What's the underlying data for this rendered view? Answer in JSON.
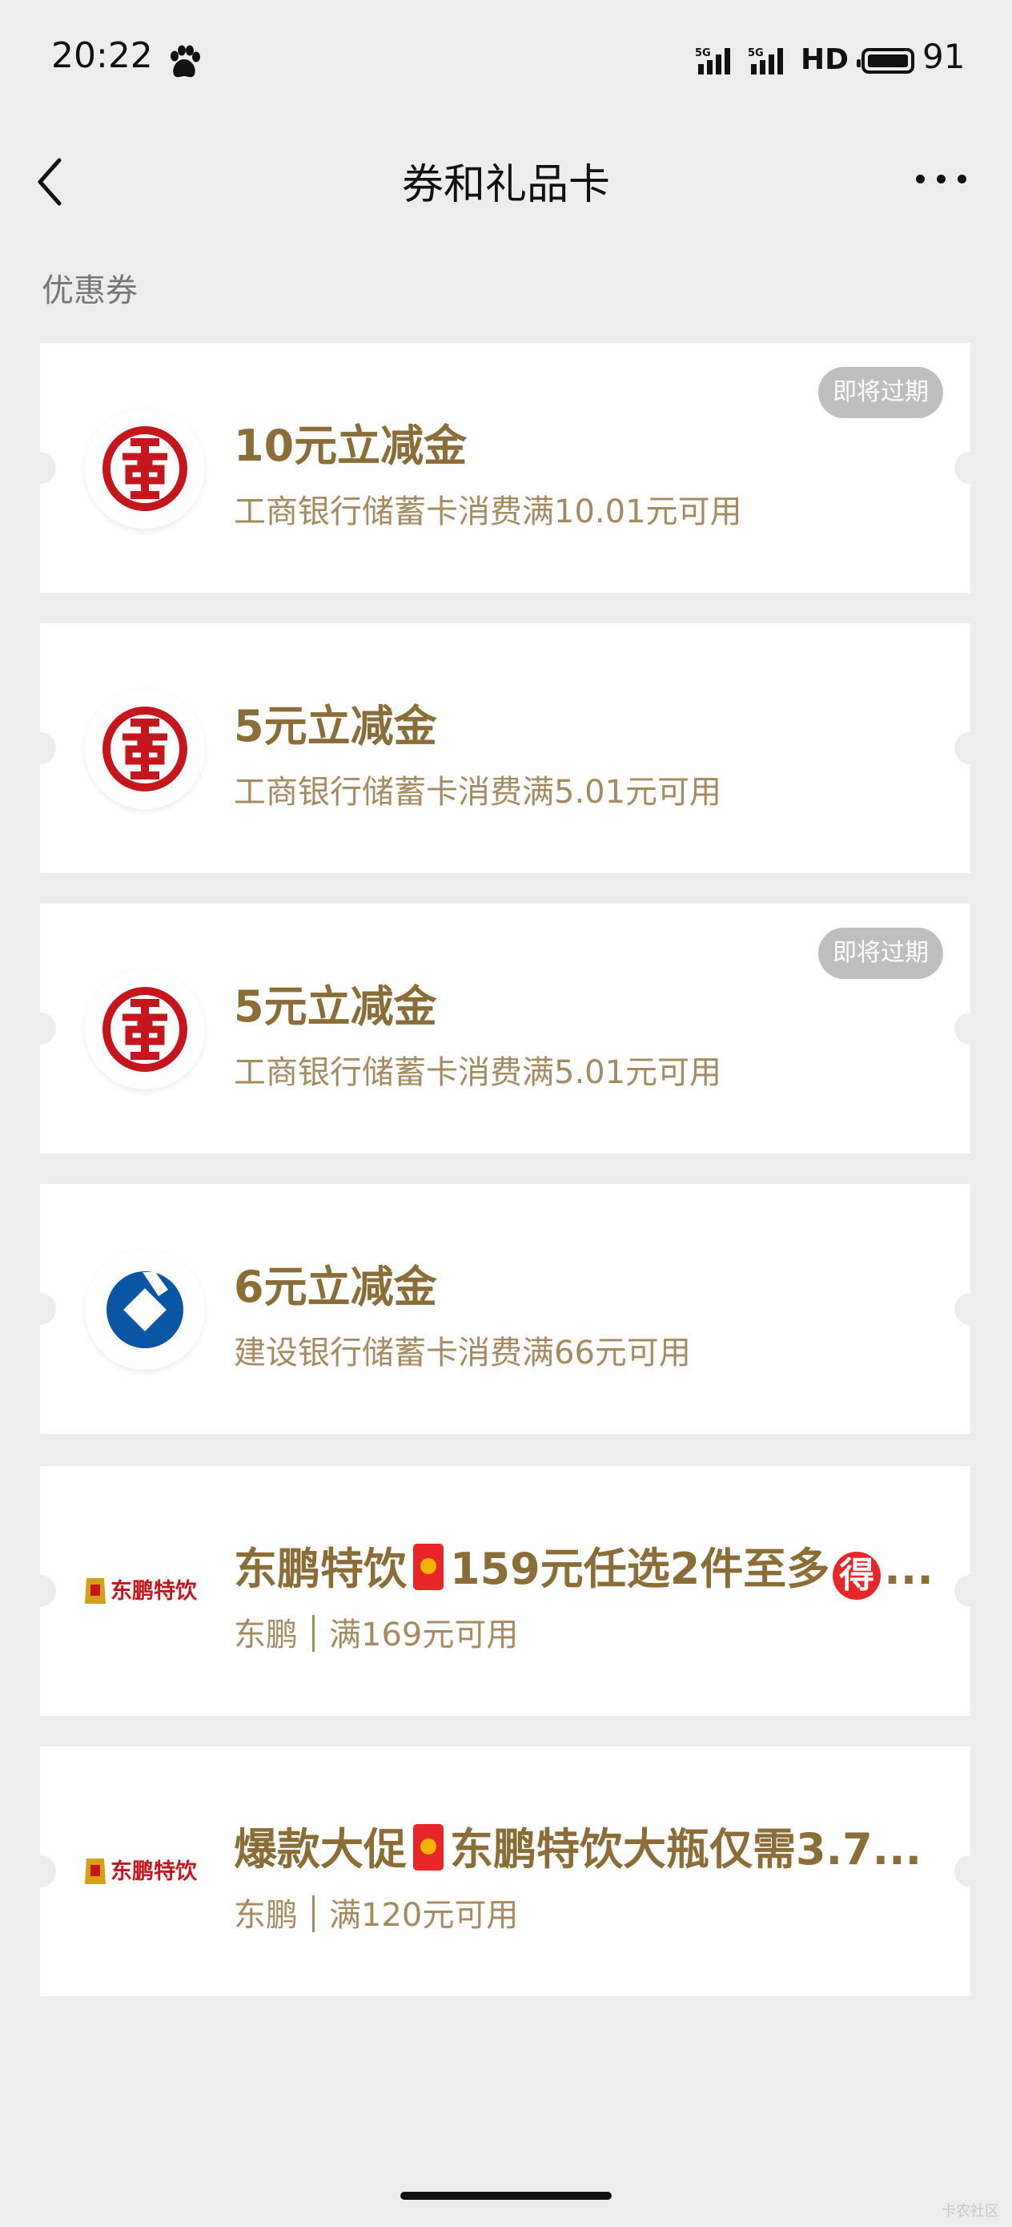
{
  "status": {
    "time": "20:22",
    "signal1": "5G",
    "signal2": "5G",
    "hd": "HD",
    "battery": "91"
  },
  "nav": {
    "title": "券和礼品卡"
  },
  "section": {
    "title": "优惠券"
  },
  "coupons": [
    {
      "title": "10元立减金",
      "desc": "工商银行储蓄卡消费满10.01元可用",
      "badge": "即将过期",
      "logo": "icbc-logo"
    },
    {
      "title": "5元立减金",
      "desc": "工商银行储蓄卡消费满5.01元可用",
      "badge": "",
      "logo": "icbc-logo"
    },
    {
      "title": "5元立减金",
      "desc": "工商银行储蓄卡消费满5.01元可用",
      "badge": "即将过期",
      "logo": "icbc-logo"
    },
    {
      "title": "6元立减金",
      "desc": "建设银行储蓄卡消费满66元可用",
      "badge": "",
      "logo": "ccb-logo"
    },
    {
      "title_a": "东鹏特饮",
      "title_b": "159元任选2件至多",
      "title_c": "得",
      "title_d": "...",
      "merchant": "东鹏",
      "desc": "满169元可用",
      "logo": "dongpeng-logo",
      "logo_text": "东鹏特饮"
    },
    {
      "title_a": "爆款大促",
      "title_b": "东鹏特饮大瓶仅需3.7...",
      "merchant": "东鹏",
      "desc": "满120元可用",
      "logo": "dongpeng-logo",
      "logo_text": "东鹏特饮"
    }
  ],
  "colors": {
    "background": "#ededed",
    "title_gold": "#8b6d37",
    "desc_gold": "#a58b62",
    "icbc_red": "#c4161c",
    "ccb_blue": "#0a56a4"
  },
  "watermark": "卡农社区"
}
